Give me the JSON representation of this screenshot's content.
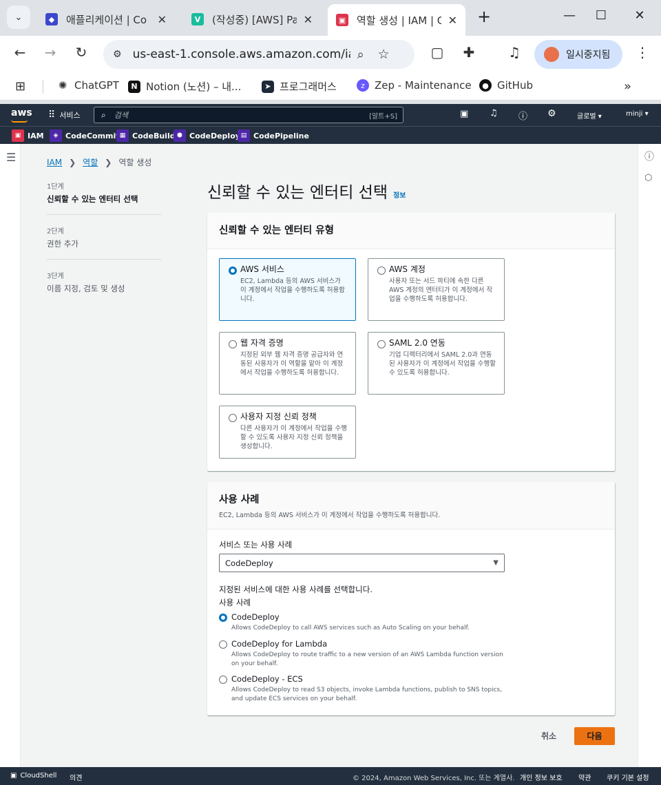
{
  "browser": {
    "tabs": [
      {
        "title": "애플리케이션 | Co",
        "favicon_color": "#3b48cc"
      },
      {
        "title": "(작성중) [AWS] Pa",
        "favicon_color": "#1abc9c"
      },
      {
        "title": "역할 생성 | IAM | G",
        "favicon_color": "#dd344c"
      }
    ],
    "new_tab": "+",
    "url": "us-east-1.console.aws.amazon.com/ia...",
    "profile_label": "일시중지됨",
    "bookmarks": [
      "ChatGPT",
      "Notion (노션) – 내...",
      "프로그래머스",
      "Zep - Maintenance",
      "GitHub"
    ]
  },
  "aws": {
    "logo": "aws",
    "services_label": "서비스",
    "search_placeholder": "검색",
    "search_shortcut": "[알트+S]",
    "region": "글로벌 ▾",
    "user": "minji ▾",
    "favorites": [
      {
        "label": "IAM",
        "color": "#dd344c"
      },
      {
        "label": "CodeCommit",
        "color": "#4d27a8"
      },
      {
        "label": "CodeBuild",
        "color": "#4d27a8"
      },
      {
        "label": "CodeDeploy",
        "color": "#4d27a8"
      },
      {
        "label": "CodePipeline",
        "color": "#4d27a8"
      }
    ]
  },
  "breadcrumb": {
    "iam": "IAM",
    "roles": "역할",
    "current": "역할 생성"
  },
  "steps": [
    {
      "num": "1단계",
      "label": "신뢰할 수 있는 엔터티 선택"
    },
    {
      "num": "2단계",
      "label": "권한 추가"
    },
    {
      "num": "3단계",
      "label": "이름 지정, 검토 및 생성"
    }
  ],
  "page": {
    "title": "신뢰할 수 있는 엔터티 선택",
    "info": "정보"
  },
  "entity": {
    "heading": "신뢰할 수 있는 엔터티 유형",
    "options": [
      {
        "title": "AWS 서비스",
        "desc": "EC2, Lambda 등의 AWS 서비스가 이 계정에서 작업을 수행하도록 허용합니다.",
        "selected": true
      },
      {
        "title": "AWS 계정",
        "desc": "사용자 또는 서드 파티에 속한 다른 AWS 계정의 엔터티가 이 계정에서 작업을 수행하도록 허용합니다.",
        "selected": false
      },
      {
        "title": "웹 자격 증명",
        "desc": "지정된 외부 웹 자격 증명 공급자와 연동된 사용자가 이 역할을 맡아 이 계정에서 작업을 수행하도록 허용합니다.",
        "selected": false
      },
      {
        "title": "SAML 2.0 연동",
        "desc": "기업 디렉터리에서 SAML 2.0과 연동된 사용자가 이 계정에서 작업을 수행할 수 있도록 허용합니다.",
        "selected": false
      },
      {
        "title": "사용자 지정 신뢰 정책",
        "desc": "다른 사용자가 이 계정에서 작업을 수행할 수 있도록 사용자 지정 신뢰 정책을 생성합니다.",
        "selected": false
      }
    ]
  },
  "usecase": {
    "heading": "사용 사례",
    "desc": "EC2, Lambda 등의 AWS 서비스가 이 계정에서 작업을 수행하도록 허용합니다.",
    "select_label": "서비스 또는 사용 사례",
    "select_value": "CodeDeploy",
    "prompt": "지정된 서비스에 대한 사용 사례를 선택합니다.",
    "group_label": "사용 사례",
    "options": [
      {
        "title": "CodeDeploy",
        "desc": "Allows CodeDeploy to call AWS services such as Auto Scaling on your behalf.",
        "selected": true
      },
      {
        "title": "CodeDeploy for Lambda",
        "desc": "Allows CodeDeploy to route traffic to a new version of an AWS Lambda function version on your behalf.",
        "selected": false
      },
      {
        "title": "CodeDeploy - ECS",
        "desc": "Allows CodeDeploy to read S3 objects, invoke Lambda functions, publish to SNS topics, and update ECS services on your behalf.",
        "selected": false
      }
    ]
  },
  "actions": {
    "cancel": "취소",
    "next": "다음"
  },
  "footer": {
    "cloudshell": "CloudShell",
    "feedback": "의견",
    "copyright": "© 2024, Amazon Web Services, Inc. 또는 계열사.",
    "privacy": "개인 정보 보호",
    "terms": "약관",
    "cookies": "쿠키 기본 설정"
  }
}
